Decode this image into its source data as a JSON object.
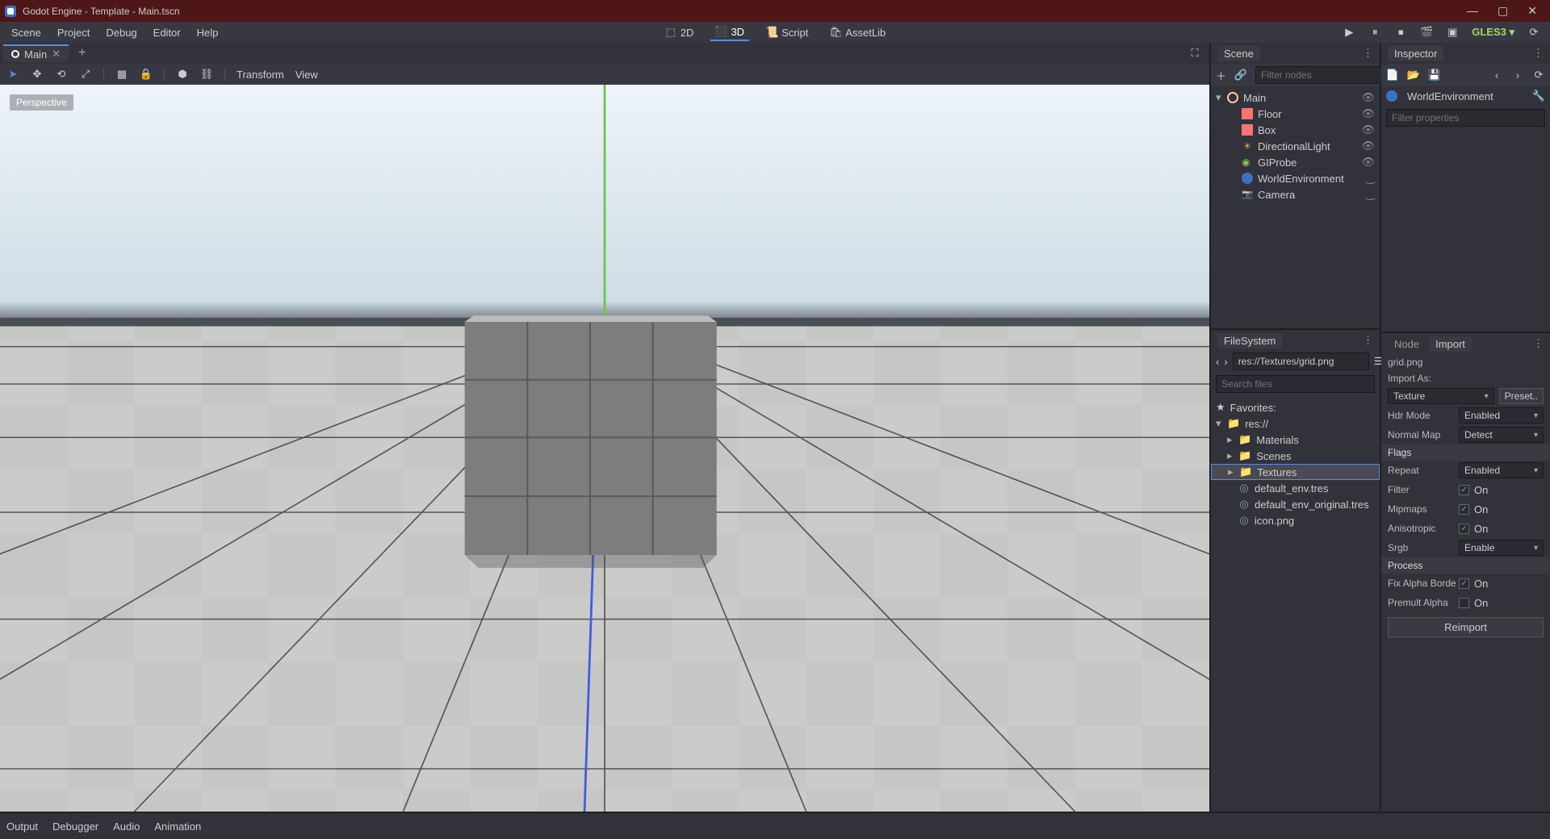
{
  "window": {
    "title": "Godot Engine - Template - Main.tscn"
  },
  "menubar": {
    "items": [
      "Scene",
      "Project",
      "Debug",
      "Editor",
      "Help"
    ]
  },
  "workspace_modes": {
    "d2": "2D",
    "d3": "3D",
    "script": "Script",
    "assetlib": "AssetLib",
    "active": "3D"
  },
  "renderer": "GLES3",
  "scene_tab": {
    "label": "Main"
  },
  "viewport": {
    "toolbar": {
      "transform": "Transform",
      "view": "View"
    },
    "badge": "Perspective"
  },
  "scene_panel": {
    "title": "Scene",
    "filter_placeholder": "Filter nodes",
    "nodes": [
      {
        "name": "Main",
        "indent": 0,
        "icon": "spatial",
        "chev": "▾",
        "eye": true
      },
      {
        "name": "Floor",
        "indent": 1,
        "icon": "mesh",
        "eye": true
      },
      {
        "name": "Box",
        "indent": 1,
        "icon": "mesh",
        "eye": true
      },
      {
        "name": "DirectionalLight",
        "indent": 1,
        "icon": "light",
        "eye": true
      },
      {
        "name": "GIProbe",
        "indent": 1,
        "icon": "gi",
        "eye": true
      },
      {
        "name": "WorldEnvironment",
        "indent": 1,
        "icon": "env",
        "eye": false
      },
      {
        "name": "Camera",
        "indent": 1,
        "icon": "cam",
        "eye": false
      }
    ]
  },
  "filesystem": {
    "title": "FileSystem",
    "path": "res://Textures/grid.png",
    "search_placeholder": "Search files",
    "favorites": "Favorites:",
    "root": "res://",
    "folders": [
      "Materials",
      "Scenes",
      "Textures"
    ],
    "files": [
      "default_env.tres",
      "default_env_original.tres",
      "icon.png"
    ],
    "selected": "Textures"
  },
  "inspector": {
    "title": "Inspector",
    "object": "WorldEnvironment",
    "filter_placeholder": "Filter properties"
  },
  "import": {
    "tabs": {
      "node": "Node",
      "import": "Import"
    },
    "file": "grid.png",
    "import_as_label": "Import As:",
    "type": "Texture",
    "preset": "Preset..",
    "props": [
      {
        "label": "Hdr Mode",
        "type": "dd",
        "value": "Enabled"
      },
      {
        "label": "Normal Map",
        "type": "dd",
        "value": "Detect"
      }
    ],
    "flags_label": "Flags",
    "flags": [
      {
        "label": "Repeat",
        "type": "dd",
        "value": "Enabled"
      },
      {
        "label": "Filter",
        "type": "chk",
        "value": "On"
      },
      {
        "label": "Mipmaps",
        "type": "chk",
        "value": "On"
      },
      {
        "label": "Anisotropic",
        "type": "chk",
        "value": "On"
      },
      {
        "label": "Srgb",
        "type": "dd",
        "value": "Enable"
      }
    ],
    "process_label": "Process",
    "process": [
      {
        "label": "Fix Alpha Borde",
        "type": "chk",
        "value": "On"
      },
      {
        "label": "Premult Alpha",
        "type": "chk_off",
        "value": "On"
      }
    ],
    "reimport": "Reimport"
  },
  "bottom_tabs": [
    "Output",
    "Debugger",
    "Audio",
    "Animation"
  ]
}
